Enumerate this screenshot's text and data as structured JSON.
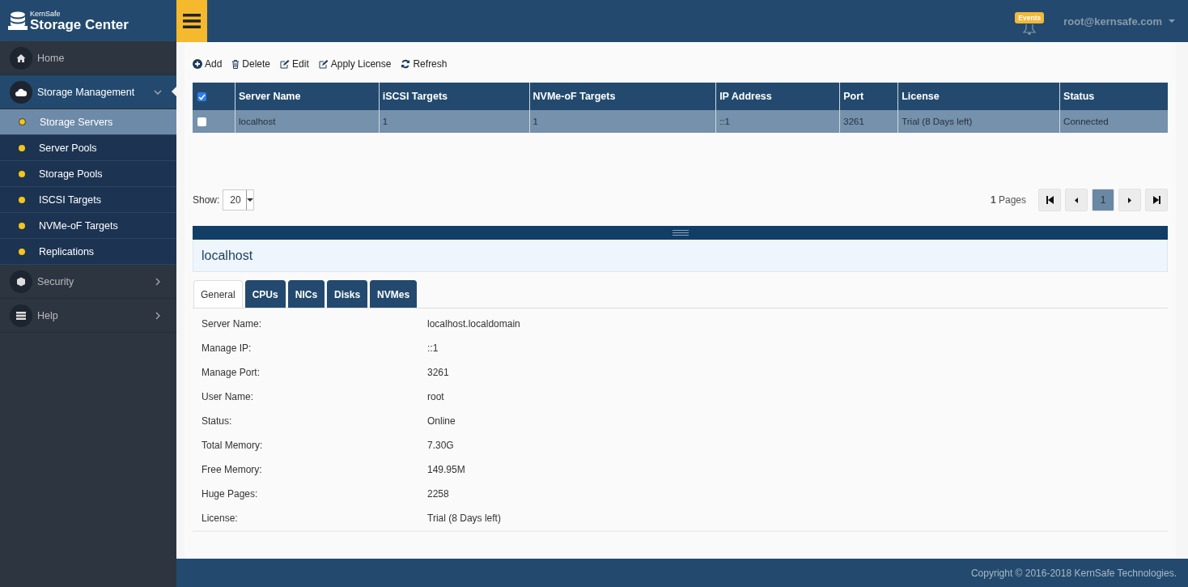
{
  "brand": {
    "small": "KernSafe",
    "title": "Storage Center"
  },
  "header": {
    "badge": "Events",
    "user": "root@kernsafe.com"
  },
  "sidebar": {
    "items": [
      {
        "label": "Home",
        "selected": false
      },
      {
        "label": "Storage Management",
        "selected": true,
        "expanded": true,
        "children": [
          {
            "label": "Storage Servers",
            "selected": true
          },
          {
            "label": "Server Pools",
            "selected": false
          },
          {
            "label": "Storage Pools",
            "selected": false
          },
          {
            "label": "ISCSI Targets",
            "selected": false
          },
          {
            "label": "NVMe-oF Targets",
            "selected": false
          },
          {
            "label": "Replications",
            "selected": false
          }
        ]
      },
      {
        "label": "Security",
        "selected": false,
        "expanded": false
      },
      {
        "label": "Help",
        "selected": false,
        "expanded": false
      }
    ]
  },
  "toolbar": [
    {
      "kind": "add",
      "label": "Add"
    },
    {
      "kind": "delete",
      "label": "Delete"
    },
    {
      "kind": "edit",
      "label": "Edit"
    },
    {
      "kind": "edit",
      "label": "Apply License"
    },
    {
      "kind": "refresh",
      "label": "Refresh"
    }
  ],
  "table": {
    "all_checked": true,
    "columns": [
      "Server Name",
      "iSCSI Targets",
      "NVMe-oF Targets",
      "IP Address",
      "Port",
      "License",
      "Status"
    ],
    "rows": [
      {
        "checked": false,
        "selected": true,
        "cells": [
          "localhost",
          "1",
          "1",
          "::1",
          "3261",
          "Trial (8 Days left)",
          "Connected"
        ]
      }
    ]
  },
  "pager": {
    "show_label": "Show:",
    "page_size": "20",
    "count": "1",
    "pages_label": "Pages",
    "pages": [
      {
        "label": "1",
        "selected": true
      }
    ]
  },
  "details": {
    "title": "localhost",
    "tabs": [
      {
        "label": "General",
        "selected": true
      },
      {
        "label": "CPUs",
        "selected": false
      },
      {
        "label": "NICs",
        "selected": false
      },
      {
        "label": "Disks",
        "selected": false
      },
      {
        "label": "NVMes",
        "selected": false
      }
    ],
    "fields": [
      {
        "label": "Server Name:",
        "value": "localhost.localdomain"
      },
      {
        "label": "Manage IP:",
        "value": "::1"
      },
      {
        "label": "Manage Port:",
        "value": "3261"
      },
      {
        "label": "User Name:",
        "value": "root"
      },
      {
        "label": "Status:",
        "value": "Online"
      },
      {
        "label": "Total Memory:",
        "value": "7.30G"
      },
      {
        "label": "Free Memory:",
        "value": "149.95M"
      },
      {
        "label": "Huge Pages:",
        "value": "2258"
      },
      {
        "label": "License:",
        "value": "Trial (8 Days left)"
      }
    ]
  },
  "footer": "Copyright © 2016-2018 KernSafe Technologies."
}
